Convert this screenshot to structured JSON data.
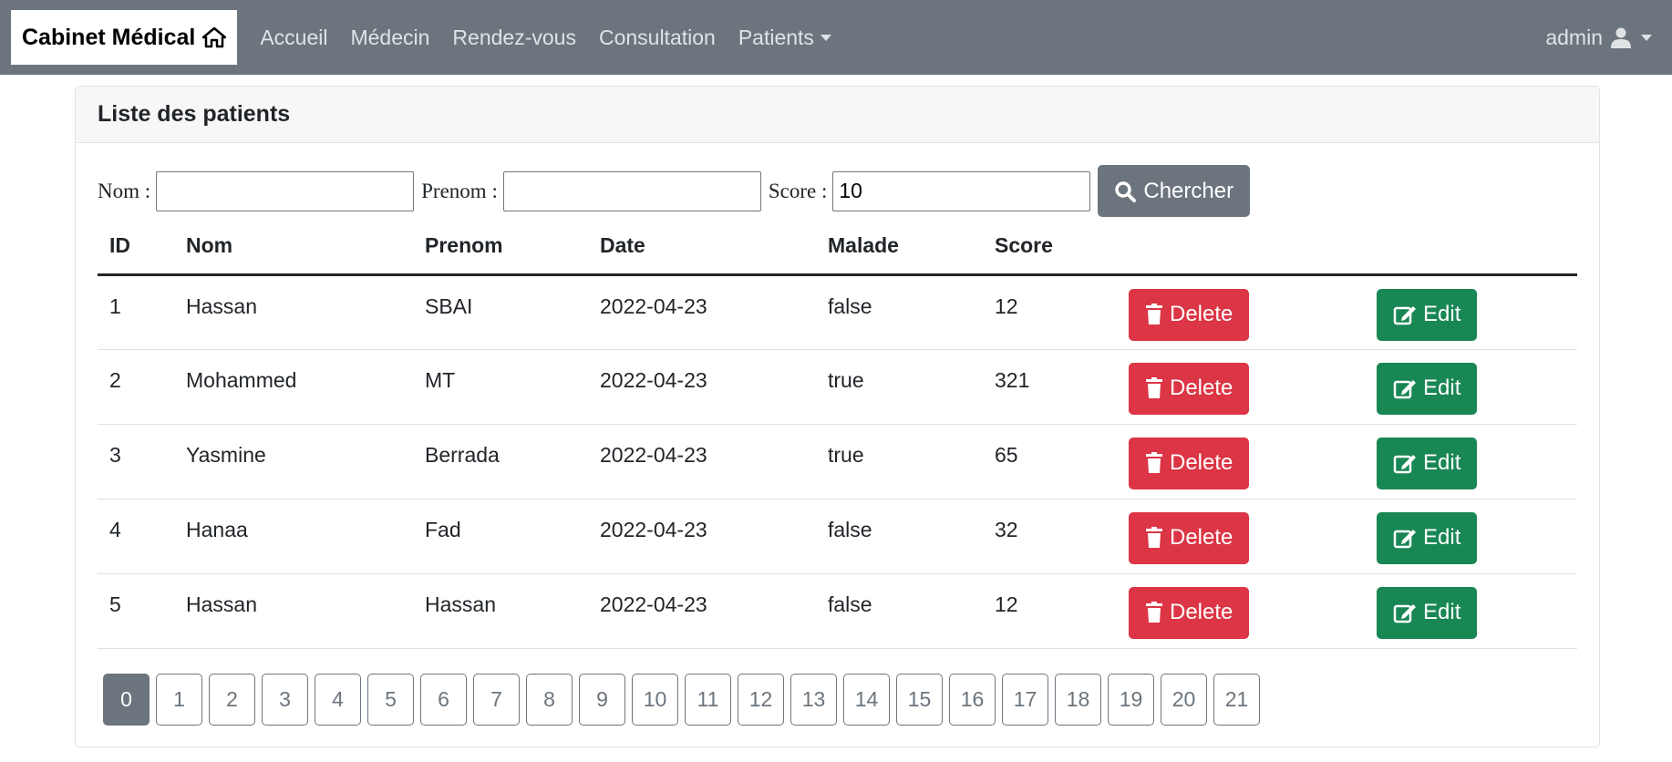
{
  "navbar": {
    "brand": "Cabinet Médical",
    "links": [
      "Accueil",
      "Médecin",
      "Rendez-vous",
      "Consultation"
    ],
    "dropdown": "Patients",
    "user": "admin"
  },
  "card": {
    "title": "Liste des patients"
  },
  "search": {
    "nom_label": "Nom :",
    "nom_value": "",
    "prenom_label": "Prenom :",
    "prenom_value": "",
    "score_label": "Score :",
    "score_value": "10",
    "button_label": "Chercher"
  },
  "table": {
    "headers": [
      "ID",
      "Nom",
      "Prenom",
      "Date",
      "Malade",
      "Score"
    ],
    "delete_label": "Delete",
    "edit_label": "Edit",
    "rows": [
      {
        "id": "1",
        "nom": "Hassan",
        "prenom": "SBAI",
        "date": "2022-04-23",
        "malade": "false",
        "score": "12"
      },
      {
        "id": "2",
        "nom": "Mohammed",
        "prenom": "MT",
        "date": "2022-04-23",
        "malade": "true",
        "score": "321"
      },
      {
        "id": "3",
        "nom": "Yasmine",
        "prenom": "Berrada",
        "date": "2022-04-23",
        "malade": "true",
        "score": "65"
      },
      {
        "id": "4",
        "nom": "Hanaa",
        "prenom": "Fad",
        "date": "2022-04-23",
        "malade": "false",
        "score": "32"
      },
      {
        "id": "5",
        "nom": "Hassan",
        "prenom": "Hassan",
        "date": "2022-04-23",
        "malade": "false",
        "score": "12"
      }
    ]
  },
  "pagination": {
    "pages": [
      "0",
      "1",
      "2",
      "3",
      "4",
      "5",
      "6",
      "7",
      "8",
      "9",
      "10",
      "11",
      "12",
      "13",
      "14",
      "15",
      "16",
      "17",
      "18",
      "19",
      "20",
      "21"
    ],
    "active": "0"
  },
  "colors": {
    "navbar": "#6c757d",
    "delete": "#dc3545",
    "edit": "#198754",
    "search": "#6c757d"
  },
  "icons": {
    "brand": "home-icon",
    "user": "user-icon",
    "search": "search-icon",
    "delete": "trash-icon",
    "edit": "edit-icon"
  }
}
